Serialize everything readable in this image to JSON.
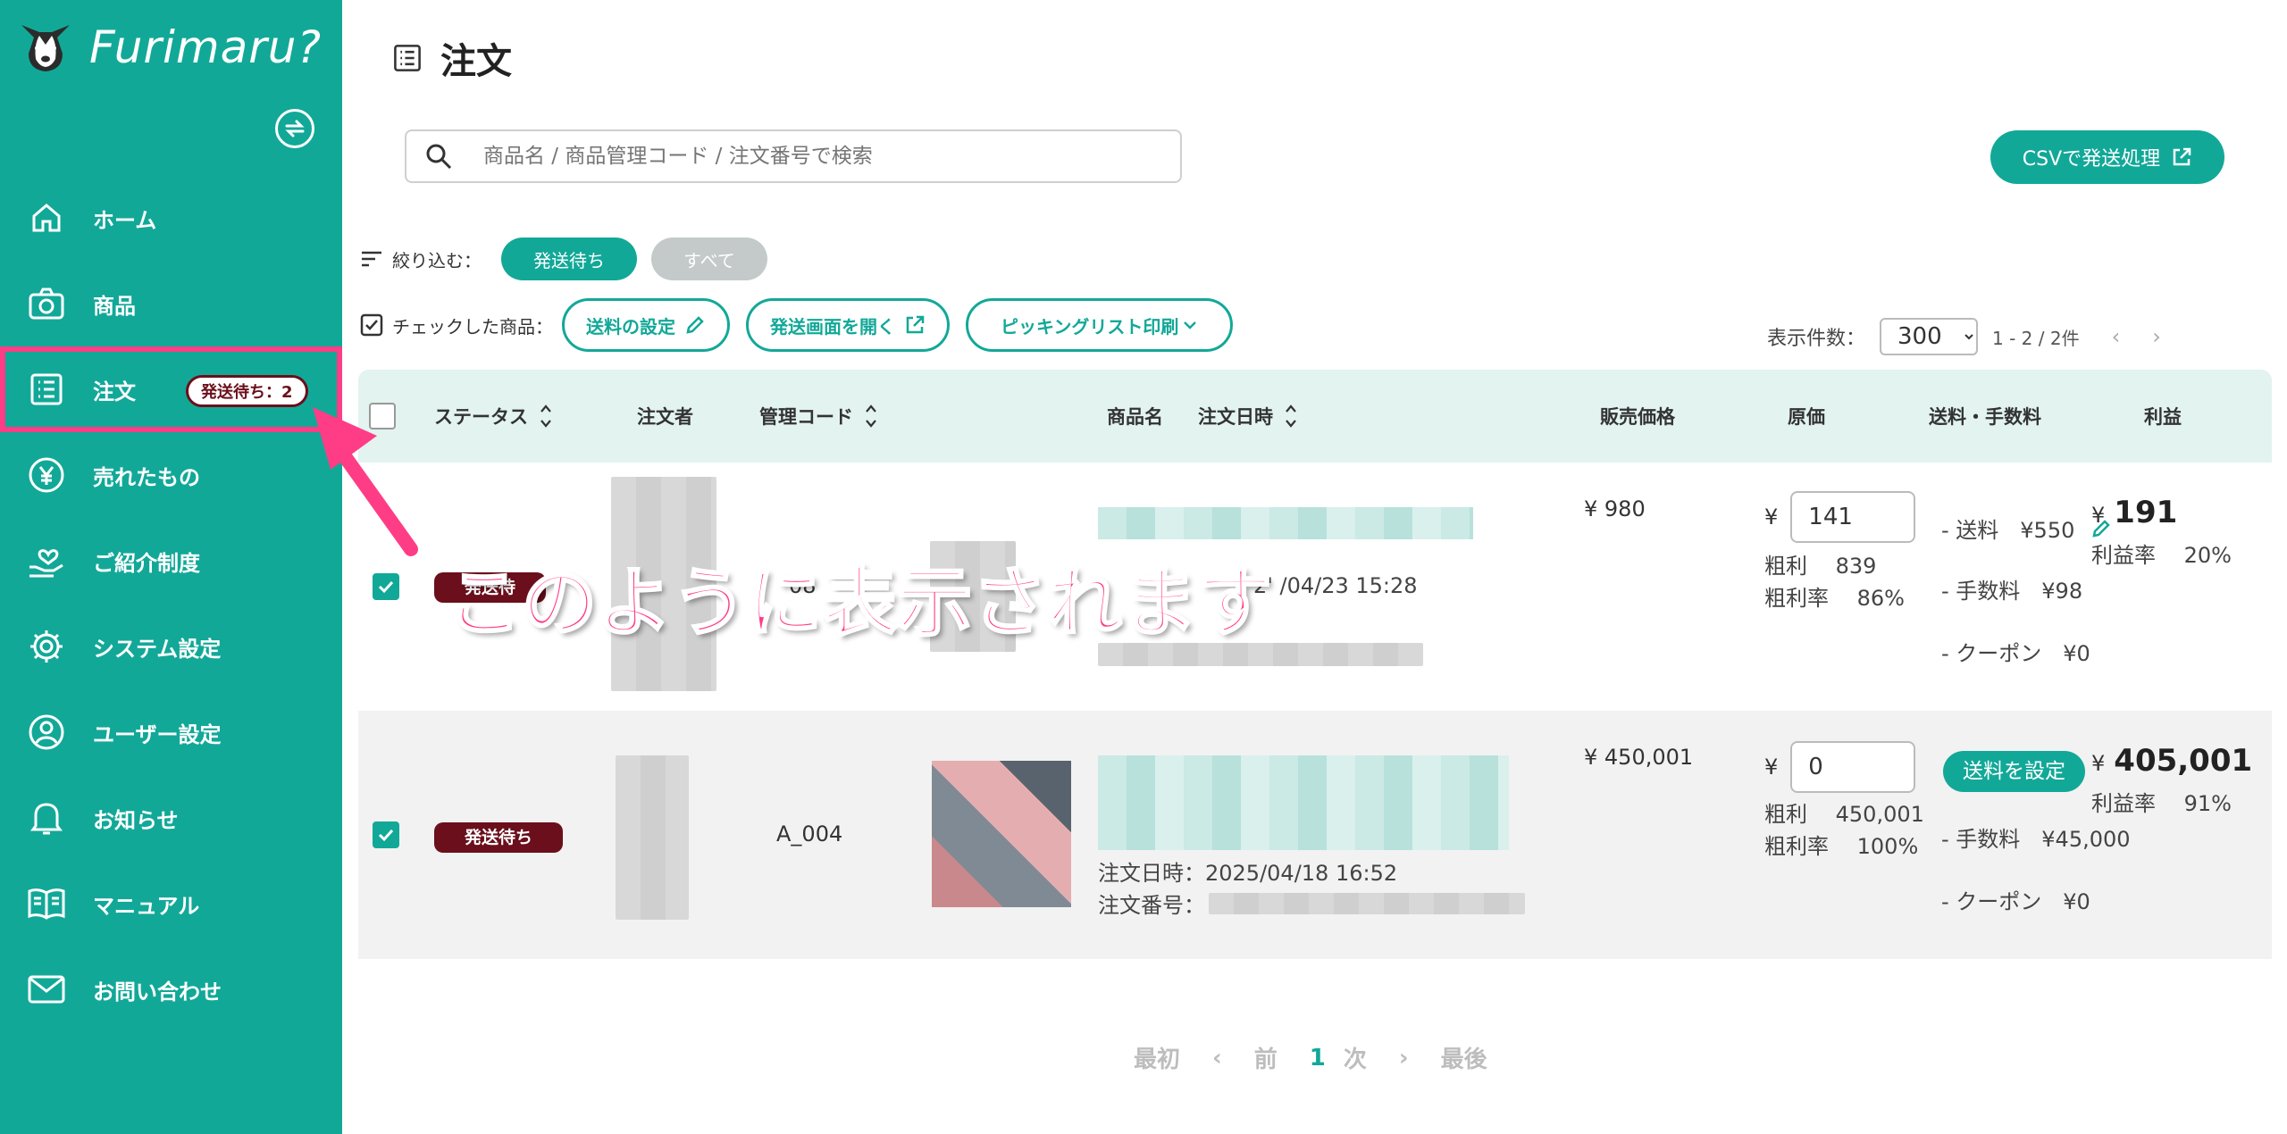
{
  "app": {
    "brand": "Furimaru?"
  },
  "sidebar": {
    "items": [
      {
        "label": "ホーム",
        "icon": "home-icon"
      },
      {
        "label": "商品",
        "icon": "camera-icon"
      },
      {
        "label": "注文",
        "icon": "list-icon",
        "badge": "発送待ち：2"
      },
      {
        "label": "売れたもの",
        "icon": "yen-icon"
      },
      {
        "label": "ご紹介制度",
        "icon": "hand-heart-icon"
      },
      {
        "label": "システム設定",
        "icon": "gear-icon"
      },
      {
        "label": "ユーザー設定",
        "icon": "user-icon"
      },
      {
        "label": "お知らせ",
        "icon": "bell-icon"
      },
      {
        "label": "マニュアル",
        "icon": "book-icon"
      },
      {
        "label": "お問い合わせ",
        "icon": "mail-icon"
      }
    ]
  },
  "page": {
    "title": "注文"
  },
  "search": {
    "placeholder": "商品名 / 商品管理コード / 注文番号で検索"
  },
  "toolbar": {
    "csv_label": "CSVで発送処理",
    "filter_label": "絞り込む：",
    "filter_pending": "発送待ち",
    "filter_all": "すべて",
    "checked_label": "チェックした商品：",
    "shipping_fee_btn": "送料の設定",
    "open_shipping_btn": "発送画面を開く",
    "picking_btn": "ピッキングリスト印刷"
  },
  "pager": {
    "per_page_label": "表示件数：",
    "per_page_value": "300",
    "range": "1 - 2 / 2件",
    "first": "最初",
    "prev": "前",
    "current": "1",
    "next": "次",
    "last": "最後"
  },
  "table": {
    "headers": {
      "status": "ステータス",
      "buyer": "注文者",
      "code": "管理コード",
      "product": "商品名",
      "order_date": "注文日時",
      "price": "販売価格",
      "cost": "原価",
      "fees": "送料・手数料",
      "profit": "利益"
    },
    "rows": [
      {
        "status": "発送待",
        "code": "08",
        "order_date_value": "2' /04/23 15:28",
        "price": "¥ 980",
        "cost_currency": "¥",
        "cost": "141",
        "gross_label": "粗利",
        "gross": "839",
        "gross_rate_label": "粗利率",
        "gross_rate": "86%",
        "shipping": "- 送料　¥550",
        "fee": "- 手数料　¥98",
        "coupon": "- クーポン　¥0",
        "profit_currency": "¥",
        "profit": "191",
        "profit_rate_label": "利益率",
        "profit_rate": "20%"
      },
      {
        "status": "発送待ち",
        "code": "A_004",
        "order_date_label": "注文日時：",
        "order_date_value": "2025/04/18 16:52",
        "order_no_label": "注文番号：",
        "price": "¥ 450,001",
        "cost_currency": "¥",
        "cost": "0",
        "gross_label": "粗利",
        "gross": "450,001",
        "gross_rate_label": "粗利率",
        "gross_rate": "100%",
        "set_fee_label": "送料を設定",
        "fee": "- 手数料　¥45,000",
        "coupon": "- クーポン　¥0",
        "profit_currency": "¥",
        "profit": "405,001",
        "profit_rate_label": "利益率",
        "profit_rate": "91%"
      }
    ]
  },
  "annotation": {
    "text": "このように表示されます"
  },
  "colors": {
    "brand": "#12a898",
    "highlight": "#ff3d86",
    "badge": "#6a0f1b"
  }
}
